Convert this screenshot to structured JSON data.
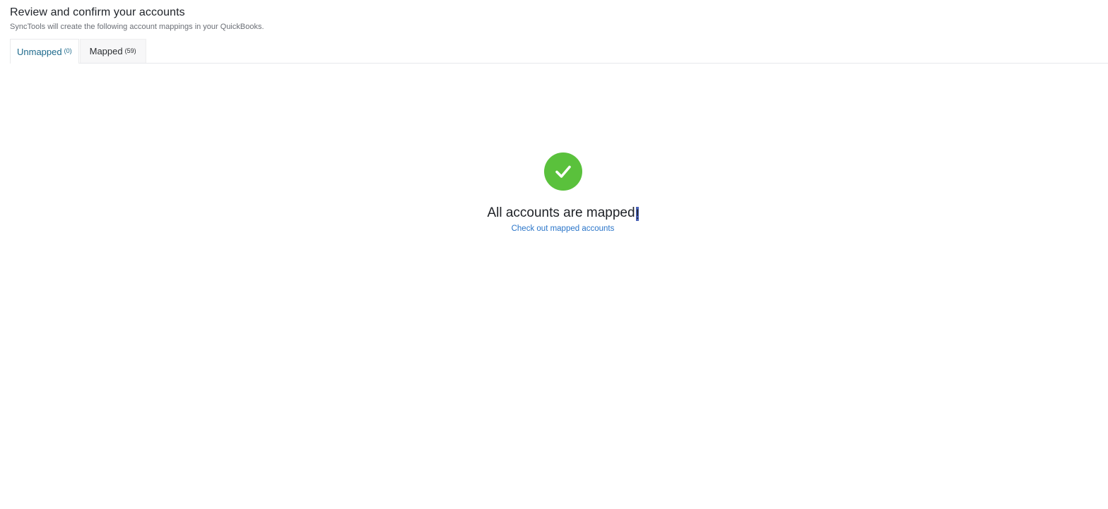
{
  "header": {
    "title": "Review and confirm your accounts",
    "subtitle": "SyncTools will create the following account mappings in your QuickBooks."
  },
  "tabs": [
    {
      "label": "Unmapped",
      "count": "(0)",
      "active": true
    },
    {
      "label": "Mapped",
      "count": "(59)",
      "active": false
    }
  ],
  "empty_state": {
    "icon": "check-circle-icon",
    "title": "All accounts are mapped",
    "title_end": "!",
    "link": "Check out mapped accounts"
  },
  "colors": {
    "accent_tab": "#1e6a8c",
    "success": "#5ac13c",
    "link": "#2a75c9"
  }
}
